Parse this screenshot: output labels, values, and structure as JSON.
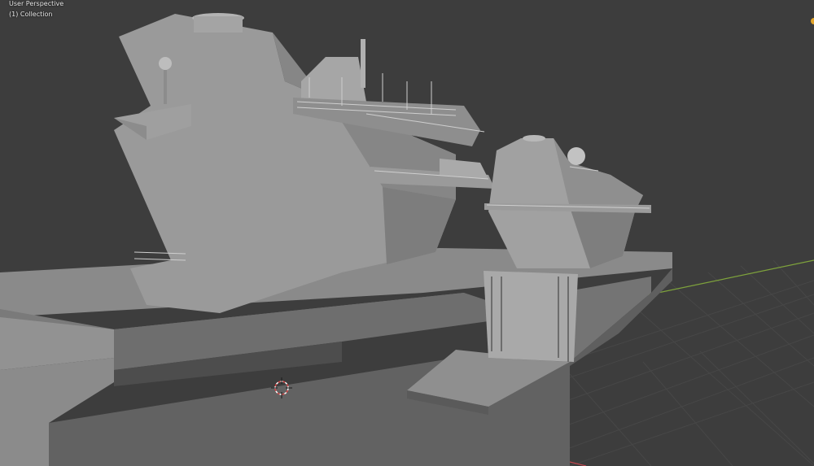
{
  "viewport": {
    "view_name": "User Perspective",
    "collection_label": "(1) Collection"
  },
  "scene": {
    "object": "aircraft-carrier-model",
    "colors": {
      "background": "#3d3d3d",
      "grid": "#474747",
      "x_axis": "#c0464f",
      "y_axis": "#7ea23c",
      "hull_light": "#8e8e8e",
      "hull_dark": "#5c5c5c",
      "island": "#9a9a9a",
      "gizmo": "#e3a52a"
    }
  }
}
